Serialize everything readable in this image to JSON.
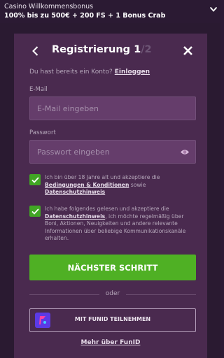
{
  "bonus_bar": {
    "title": "Casino Willkommensbonus",
    "offer": "100% bis zu 500€ + 200 FS + 1 Bonus Crab",
    "chevron_icon": "chevron-down-icon"
  },
  "modal": {
    "title": "Registrierung",
    "step_current": "1",
    "step_total": "/2",
    "back_icon": "back-arrow-icon",
    "close_icon": "close-icon",
    "login_prompt": "Du hast bereits ein Konto?",
    "login_link": "Einloggen",
    "email": {
      "label": "E-Mail",
      "placeholder": "E-Mail eingeben",
      "value": ""
    },
    "password": {
      "label": "Passwort",
      "placeholder": "Passwort eingeben",
      "value": "",
      "eye_icon": "eye-icon"
    },
    "terms": {
      "checked": true,
      "text_before": "Ich bin über 18 Jahre alt und akzeptiere die ",
      "link1": "Bedingungen & Konditionen",
      "text_middle": " sowie ",
      "link2": "Datenschutzhinweis"
    },
    "marketing": {
      "checked": true,
      "text_before": "Ich habe folgendes gelesen und akzeptiere die ",
      "link": "Datenschutzhinweis",
      "text_after": ", ich möchte regelmäßig über Boni, Aktionen, Neuigkeiten und andere relevante Informationen über beliebige Kommunikationskanäle erhalten."
    },
    "next_button": "NÄCHSTER SCHRITT",
    "divider": "oder",
    "funid_button": "MIT FUNID TEILNEHMEN",
    "funid_more": "Mehr über FunID"
  },
  "colors": {
    "accent_green": "#4fb024",
    "checkbox_green": "#41a624",
    "modal_bg": "#4a2a4f",
    "input_bg": "#653d6b",
    "funid_logo": "#5b3ae6"
  }
}
